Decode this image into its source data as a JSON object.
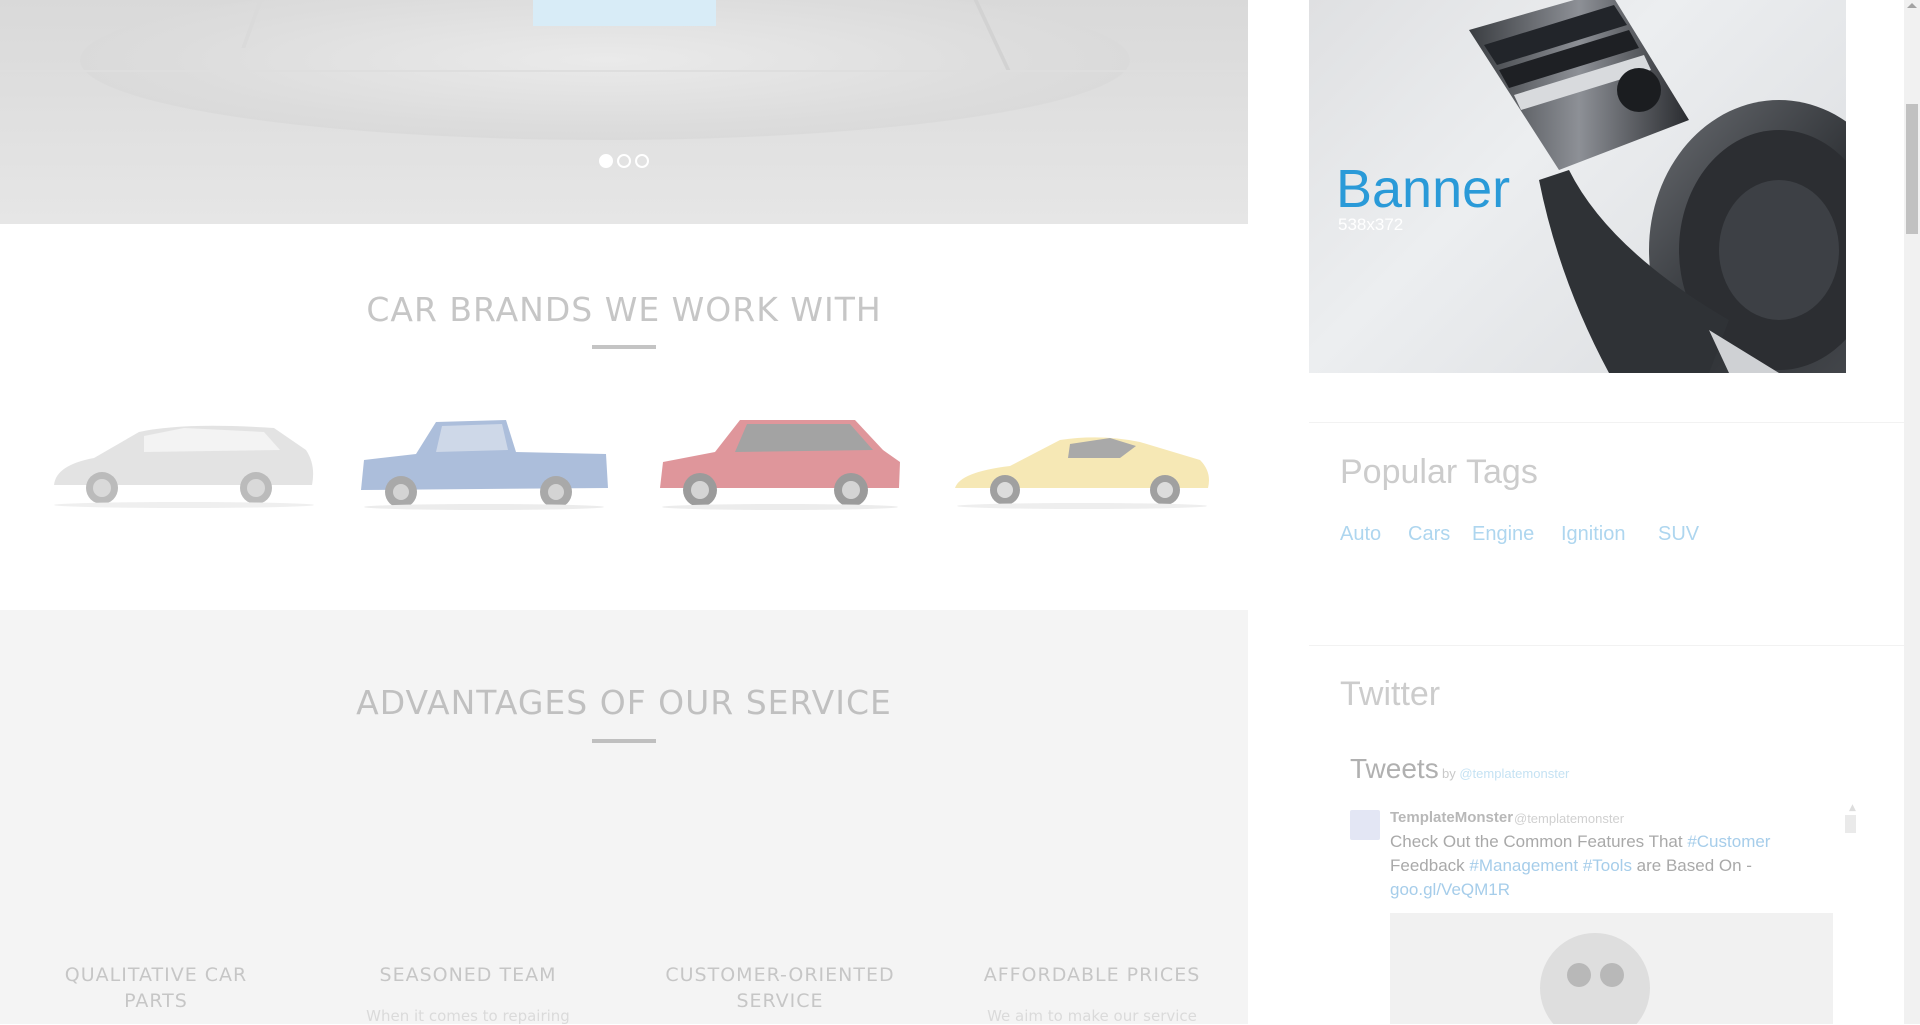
{
  "slider": {
    "dots": [
      "1",
      "2",
      "3"
    ],
    "active_dot": 0
  },
  "brands": {
    "title": "CAR BRANDS WE WORK WITH",
    "cars": [
      {
        "name": "silver-wagon",
        "color": "#c9c9c9"
      },
      {
        "name": "blue-pickup",
        "color": "#5c7fb8"
      },
      {
        "name": "red-suv",
        "color": "#c0303a"
      },
      {
        "name": "yellow-supercar",
        "color": "#efd26e"
      }
    ]
  },
  "advantages": {
    "title": "ADVANTAGES OF OUR SERVICE",
    "items": [
      {
        "title": "QUALITATIVE CAR PARTS",
        "text": ""
      },
      {
        "title": "SEASONED TEAM",
        "text": "When it comes to repairing"
      },
      {
        "title": "CUSTOMER-ORIENTED SERVICE",
        "text": ""
      },
      {
        "title": "AFFORDABLE PRICES",
        "text": "We aim to make our service"
      }
    ]
  },
  "sidebar": {
    "banner": {
      "title": "Banner",
      "size": "538x372",
      "title_color": "#2a9ad8"
    },
    "popular_tags": {
      "title": "Popular Tags",
      "tags": [
        "Auto",
        "Cars",
        "Engine",
        "Ignition",
        "SUV"
      ]
    },
    "twitter": {
      "title": "Twitter",
      "tweets_label": "Tweets",
      "by_label": "by",
      "by_handle": "@templatemonster",
      "tweet": {
        "author": "TemplateMonster",
        "handle": "@templatemonster",
        "text_parts": [
          {
            "t": "Check Out the Common Features That ",
            "hash": false
          },
          {
            "t": "#Customer",
            "hash": true
          },
          {
            "t": " Feedback ",
            "hash": false
          },
          {
            "t": "#Management",
            "hash": true
          },
          {
            "t": " ",
            "hash": false
          },
          {
            "t": "#Tools",
            "hash": true
          },
          {
            "t": " are Based On - ",
            "hash": false
          },
          {
            "t": "goo.gl/VeQM1R",
            "hash": true
          }
        ]
      }
    }
  },
  "colors": {
    "accent": "#2a9ad8",
    "tag": "#aed6ef",
    "heading": "#8e8e8e"
  }
}
